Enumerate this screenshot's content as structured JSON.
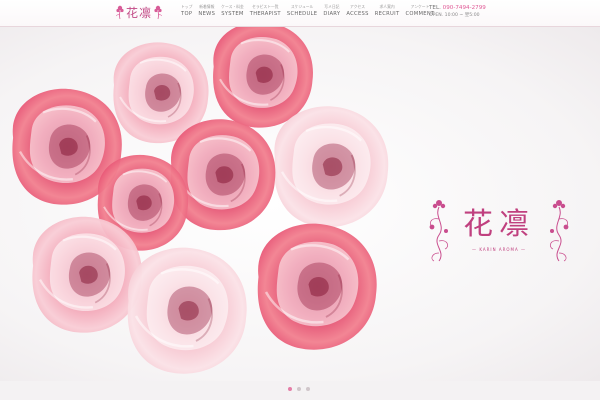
{
  "site": {
    "logo_text": "花凛"
  },
  "nav": [
    {
      "jp": "トップ",
      "en": "TOP"
    },
    {
      "jp": "新着情報",
      "en": "NEWS"
    },
    {
      "jp": "ケース・料金",
      "en": "SYSTEM"
    },
    {
      "jp": "セラピスト一覧",
      "en": "THERAPIST"
    },
    {
      "jp": "スケジュール",
      "en": "SCHEDULE"
    },
    {
      "jp": "写メ日記",
      "en": "DIARY"
    },
    {
      "jp": "アクセス",
      "en": "ACCESS"
    },
    {
      "jp": "求人案内",
      "en": "RECRUIT"
    },
    {
      "jp": "アンケート",
      "en": "COMMENT"
    }
  ],
  "contact": {
    "tel_label": "TEL.",
    "tel": "090-7494-2799",
    "hours": "OPEN. 10:00 ~ 翌5:00"
  },
  "hero": {
    "logo_name": "花凛",
    "logo_sub": "— KARIN AROMA —"
  },
  "slider": {
    "count": 3,
    "active": 0
  },
  "colors": {
    "accent": "#c0407f",
    "tel": "#e05a96",
    "dot_active": "#e57ea7",
    "dot_inactive": "#d0c6ca"
  },
  "icons": {
    "logo_flower": "flower-ornament-icon",
    "hero_ornament": "floral-scroll-icon"
  }
}
